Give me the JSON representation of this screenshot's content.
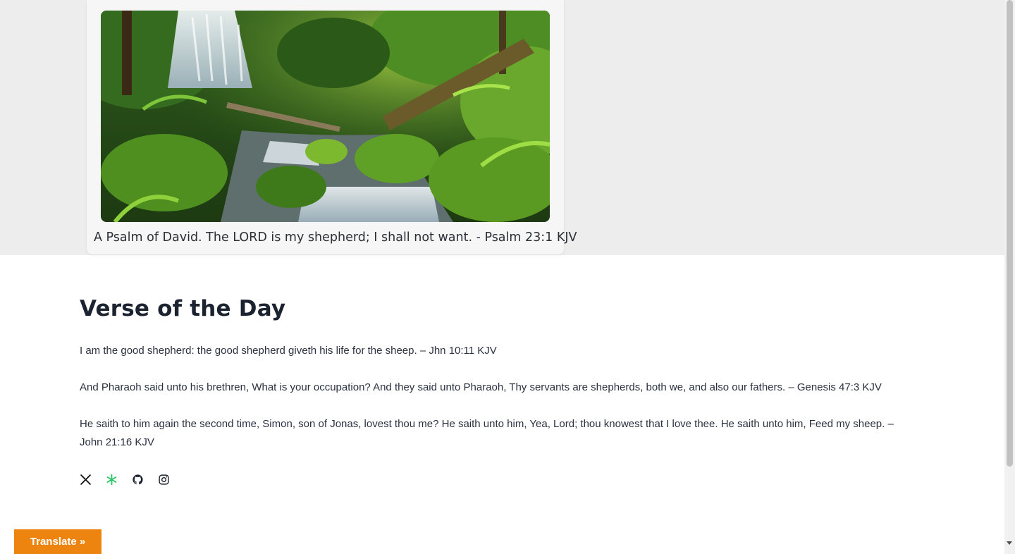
{
  "hero": {
    "caption": "A Psalm of David. The LORD is my shepherd; I shall not want. - Psalm 23:1 KJV"
  },
  "section": {
    "heading": "Verse of the Day",
    "verses": [
      "I am the good shepherd: the good shepherd giveth his life for the sheep. – Jhn 10:11 KJV",
      "And Pharaoh said unto his brethren, What is your occupation? And they said unto Pharaoh, Thy servants are shepherds, both we, and also our fathers. – Genesis 47:3 KJV",
      "He saith to him again the second time, Simon, son of Jonas, lovest thou me? He saith unto him, Yea, Lord; thou knowest that I love thee. He saith unto him, Feed my sheep. – John 21:16 KJV"
    ]
  },
  "socials": [
    {
      "icon": "x-icon"
    },
    {
      "icon": "asterisk-icon",
      "color": "#22c55e"
    },
    {
      "icon": "github-icon"
    },
    {
      "icon": "instagram-icon"
    }
  ],
  "translate": {
    "label": "Translate »",
    "color": "#ee8410"
  }
}
